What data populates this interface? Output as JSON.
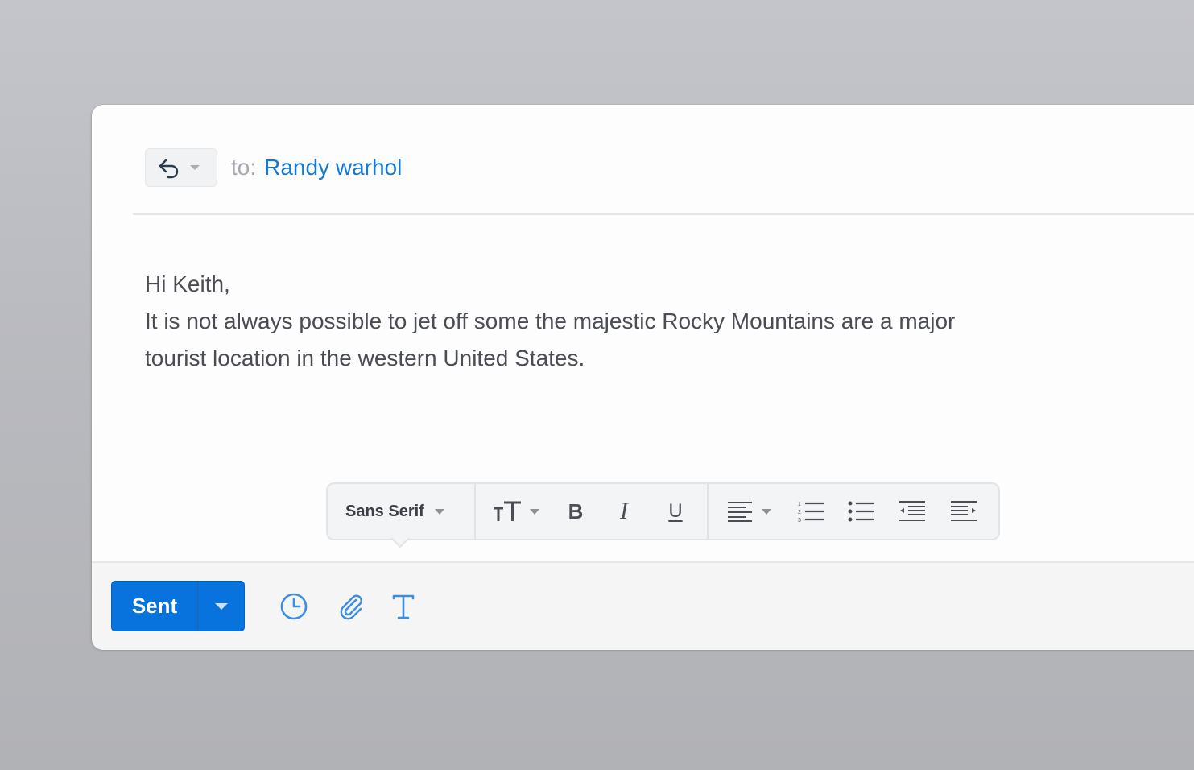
{
  "composer": {
    "to_label": "to:",
    "recipient": "Randy warhol",
    "body_greeting": "Hi Keith,",
    "body_lines": "It is not always possible to jet off some the majestic Rocky Mountains are a major tourist location in the western United States."
  },
  "format_toolbar": {
    "font_family": "Sans Serif",
    "bold_glyph": "B",
    "italic_glyph": "I",
    "underline_glyph": "U"
  },
  "footer": {
    "send_label": "Sent"
  },
  "colors": {
    "accent": "#1577d4",
    "send_button": "#0872dd",
    "icon_blue": "#3d8de0",
    "text": "#4a4d53"
  }
}
